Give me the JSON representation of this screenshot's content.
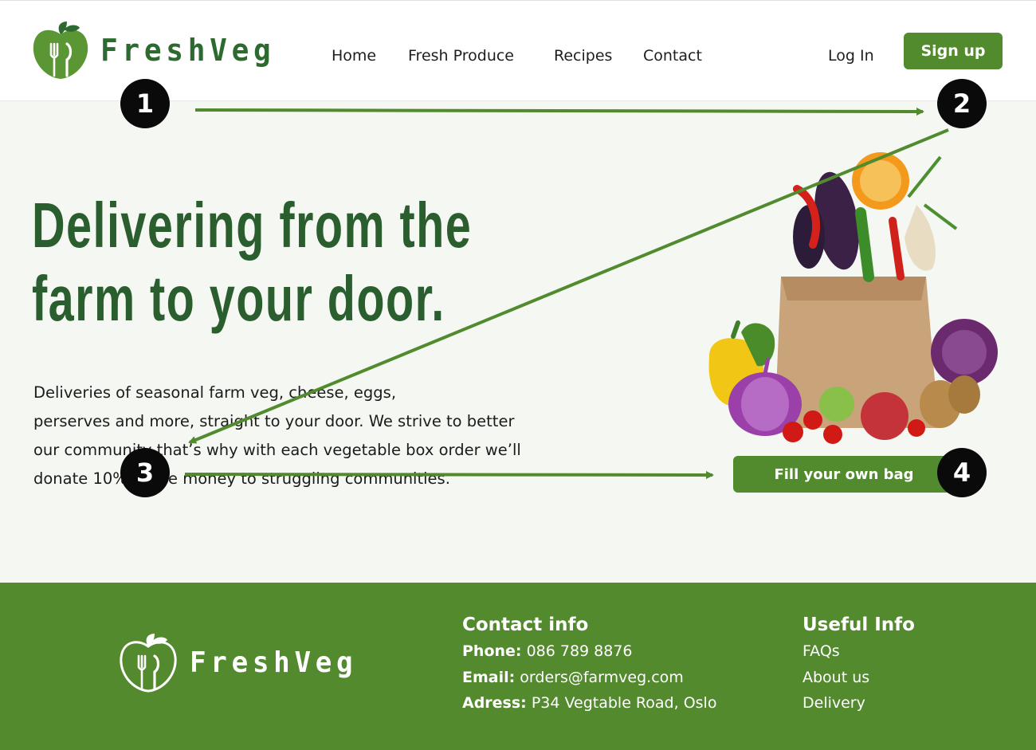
{
  "brand": {
    "name": "FreshVeg",
    "logo_icon": "apple-fork-logo-icon"
  },
  "colors": {
    "primary_green": "#528a2e",
    "headline_green": "#2b5e2e",
    "hero_bg": "#f4f7f2"
  },
  "nav": {
    "items": [
      {
        "label": "Home"
      },
      {
        "label": "Fresh Produce"
      },
      {
        "label": "Recipes"
      },
      {
        "label": "Contact"
      }
    ],
    "login_label": "Log In",
    "signup_label": "Sign up"
  },
  "hero": {
    "headline_line1": "Delivering from the",
    "headline_line2": "farm to your door.",
    "blurb_line1": "Deliveries of seasonal farm veg, cheese, eggs,",
    "blurb_line2": "perserves and more, straight to your door. We strive to better",
    "blurb_line3": "our community that’s why with each vegetable box order we’ll",
    "blurb_line4": "donate 10% of the money to struggling communities.",
    "cta_label": "Fill your own bag",
    "image_subject": "paper bag of fresh vegetables"
  },
  "footer": {
    "contact_title": "Contact info",
    "phone_label": "Phone:",
    "phone_value": "086 789 8876",
    "email_label": "Email:",
    "email_value": "orders@farmveg.com",
    "address_label": "Adress:",
    "address_value": "P34 Vegtable Road, Oslo",
    "useful_title": "Useful Info",
    "links": [
      {
        "label": "FAQs"
      },
      {
        "label": "About us"
      },
      {
        "label": "Delivery"
      }
    ]
  },
  "annotations": {
    "markers": [
      {
        "label": "1"
      },
      {
        "label": "2"
      },
      {
        "label": "3"
      },
      {
        "label": "4"
      }
    ]
  }
}
